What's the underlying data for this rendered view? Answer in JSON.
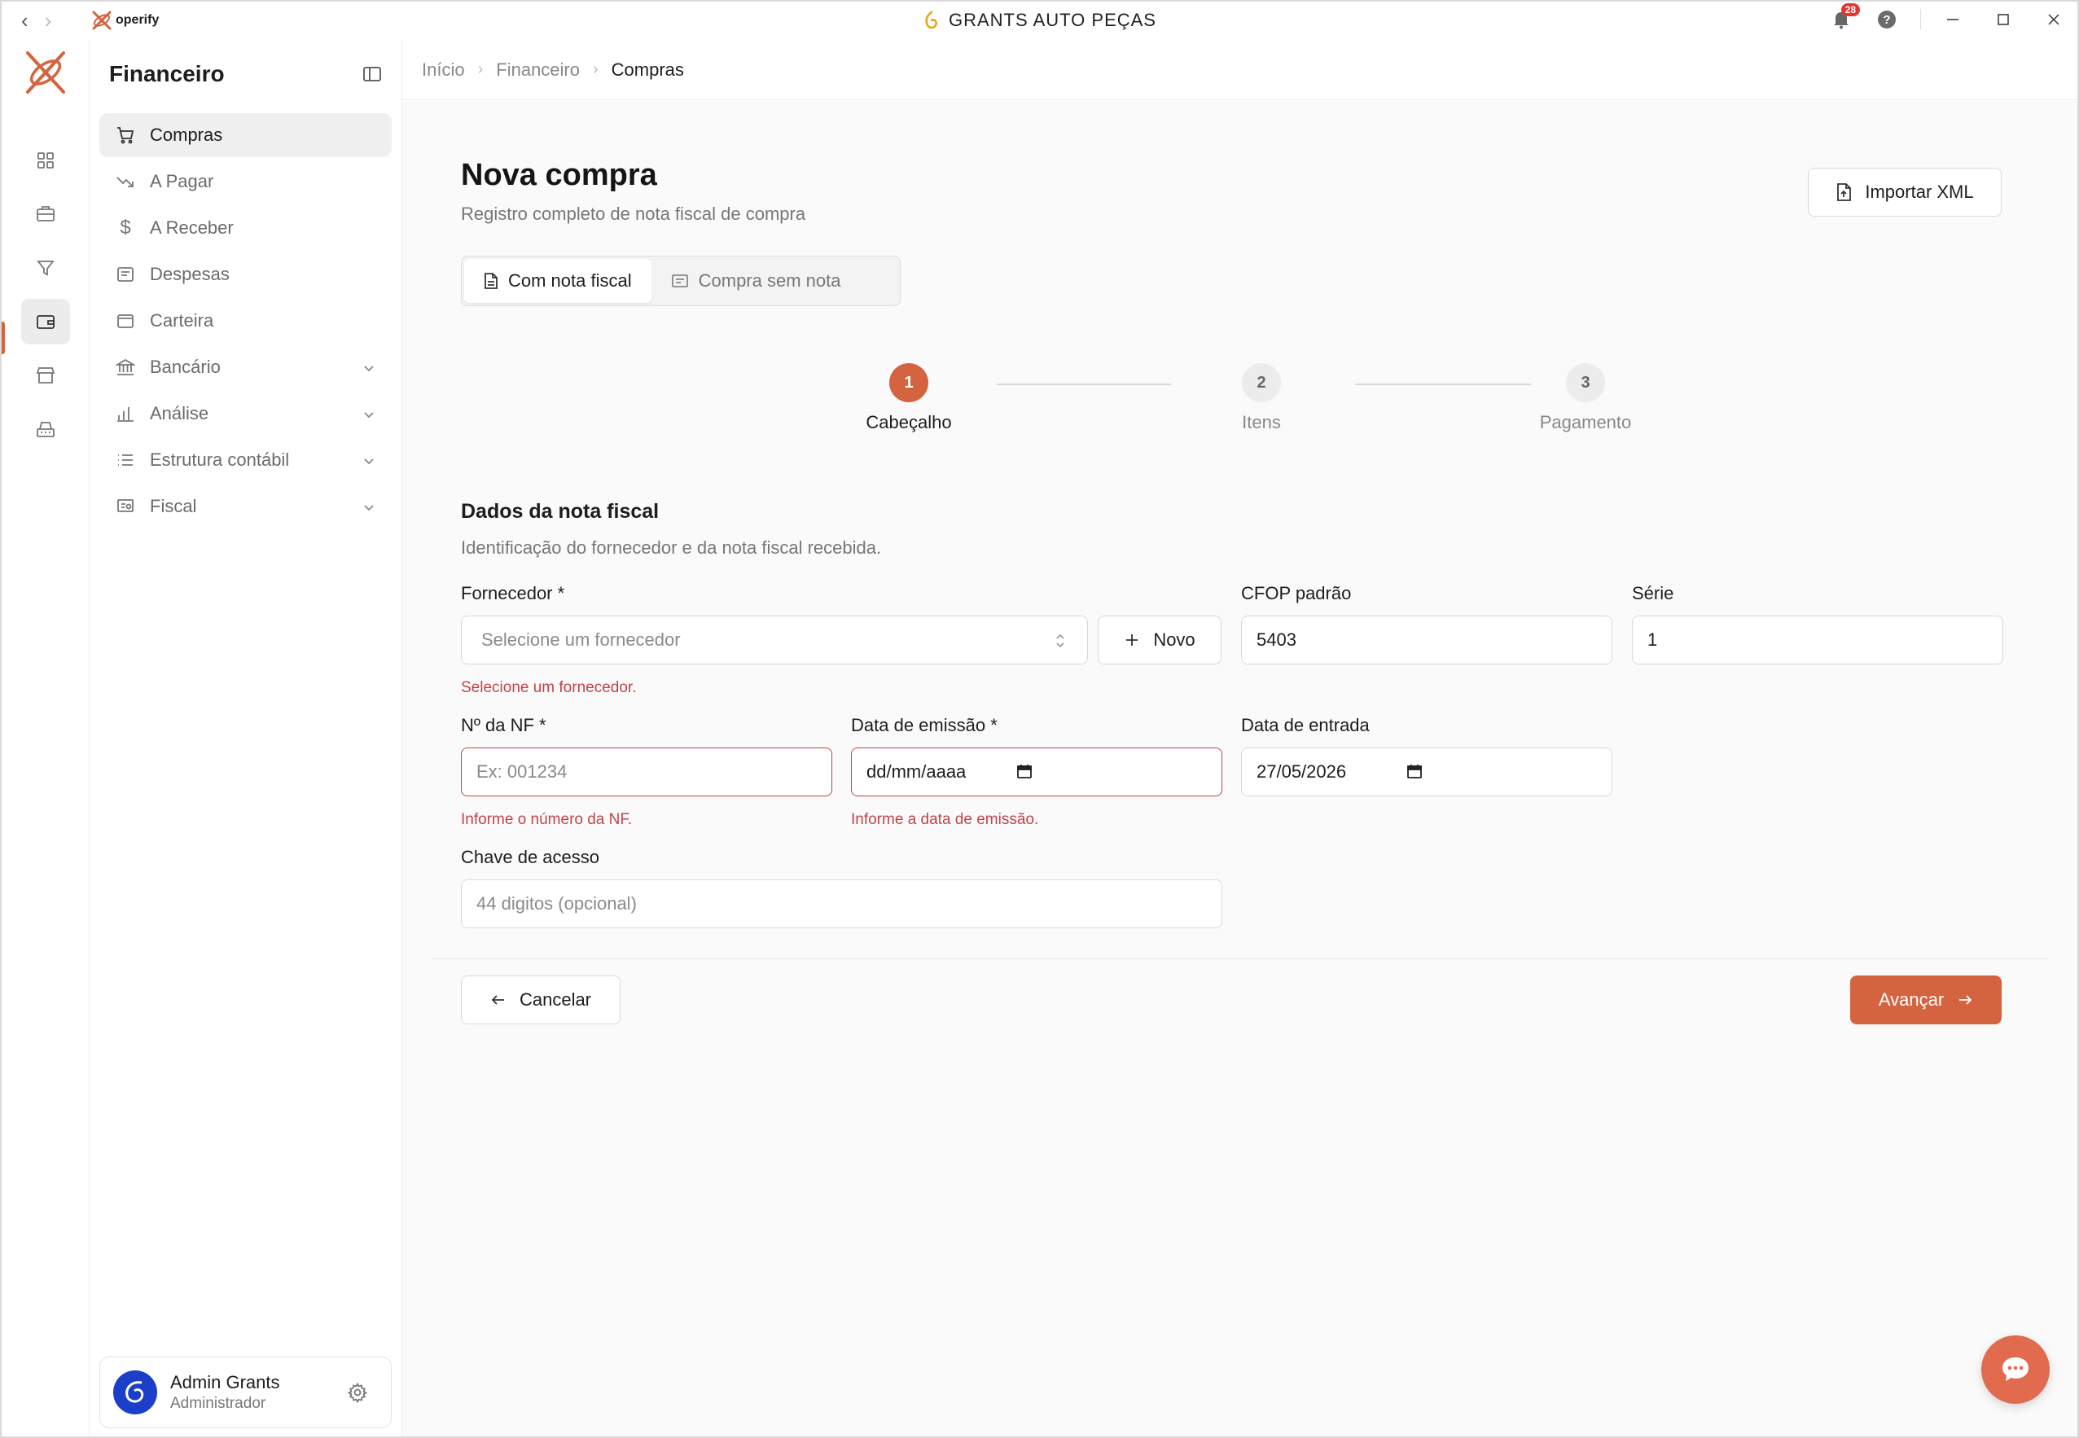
{
  "titlebar": {
    "app_logo_text": "operify",
    "title": "GRANTS AUTO PEÇAS",
    "notification_count": "28",
    "help_label": "?"
  },
  "sidebar": {
    "title": "Financeiro",
    "items": [
      {
        "label": "Compras",
        "icon": "cart-icon"
      },
      {
        "label": "A Pagar",
        "icon": "trending-down-icon"
      },
      {
        "label": "A Receber",
        "icon": "dollar-icon"
      },
      {
        "label": "Despesas",
        "icon": "receipt-icon"
      },
      {
        "label": "Carteira",
        "icon": "wallet-icon"
      },
      {
        "label": "Bancário",
        "icon": "bank-icon"
      },
      {
        "label": "Análise",
        "icon": "bar-chart-icon"
      },
      {
        "label": "Estrutura contábil",
        "icon": "list-icon"
      },
      {
        "label": "Fiscal",
        "icon": "fiscal-icon"
      }
    ],
    "user": {
      "name": "Admin Grants",
      "role": "Administrador"
    }
  },
  "breadcrumb": [
    "Início",
    "Financeiro",
    "Compras"
  ],
  "page": {
    "title": "Nova compra",
    "subtitle": "Registro completo de nota fiscal de compra",
    "import_label": "Importar XML",
    "tabs": [
      {
        "label": "Com nota fiscal",
        "active": true
      },
      {
        "label": "Compra sem nota",
        "active": false
      }
    ]
  },
  "steps": [
    {
      "number": "1",
      "label": "Cabeçalho",
      "active": true
    },
    {
      "number": "2",
      "label": "Itens",
      "active": false
    },
    {
      "number": "3",
      "label": "Pagamento",
      "active": false
    }
  ],
  "form": {
    "section_title": "Dados da nota fiscal",
    "section_subtitle": "Identificação do fornecedor e da nota fiscal recebida.",
    "supplier": {
      "label": "Fornecedor *",
      "placeholder": "Selecione um fornecedor",
      "error": "Selecione um fornecedor.",
      "new_label": "Novo"
    },
    "cfop": {
      "label": "CFOP padrão",
      "value": "5403"
    },
    "serie": {
      "label": "Série",
      "value": "1"
    },
    "nf_number": {
      "label": "Nº da NF *",
      "placeholder": "Ex: 001234",
      "error": "Informe o número da NF."
    },
    "issue_date": {
      "label": "Data de emissão *",
      "value": "dd/mm/aaaa",
      "error": "Informe a data de emissão."
    },
    "entry_date": {
      "label": "Data de entrada",
      "value": "27/05/2026"
    },
    "access_key": {
      "label": "Chave de acesso",
      "placeholder": "44 digitos (opcional)"
    }
  },
  "actions": {
    "cancel_label": "Cancelar",
    "next_label": "Avançar"
  },
  "colors": {
    "accent": "#d4633f",
    "error": "#c2434a"
  }
}
